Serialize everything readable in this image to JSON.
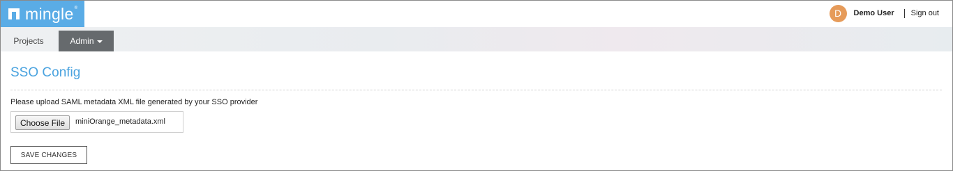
{
  "brand": {
    "name": "mingle",
    "trademark": "®",
    "color": "#5aace6"
  },
  "user": {
    "avatar_initial": "D",
    "name": "Demo User",
    "signout_label": "Sign out",
    "avatar_color": "#e69b5a"
  },
  "nav": {
    "projects_label": "Projects",
    "admin_label": "Admin"
  },
  "page": {
    "title": "SSO Config",
    "instruction": "Please upload SAML metadata XML file generated by your SSO provider",
    "file_button_label": "Choose File",
    "file_name": "miniOrange_metadata.xml",
    "save_label": "SAVE CHANGES"
  },
  "colors": {
    "title": "#4aa3df",
    "admin_tab": "#666a6d"
  }
}
